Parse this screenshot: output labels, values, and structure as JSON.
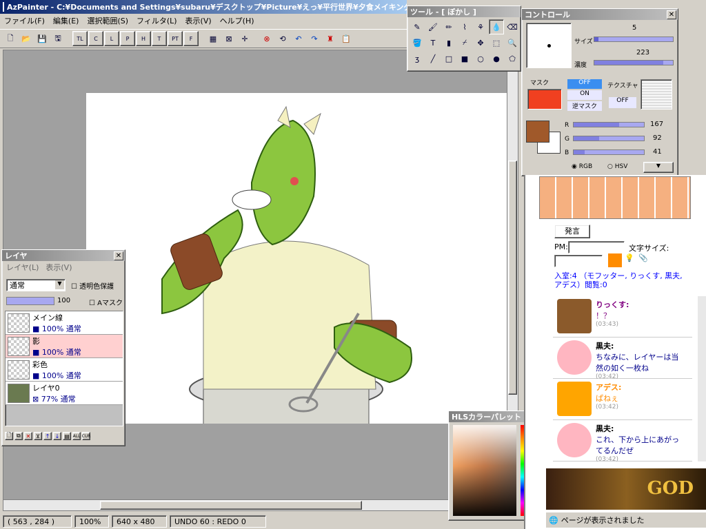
{
  "title": "AzPainter - C:¥Documents and Settings¥subaru¥デスクトップ¥Picture¥えっ¥平行世界¥夕食メイキング¥...",
  "menu": [
    "ファイル(F)",
    "編集(E)",
    "選択範囲(S)",
    "フィルタ(L)",
    "表示(V)",
    "ヘルプ(H)"
  ],
  "status": {
    "coords": "( 563 , 284 )",
    "zoom": "100%",
    "size": "640 x 480",
    "undo": "UNDO  60 : REDO   0"
  },
  "tool_window": {
    "title": "ツール - [ ぼかし ]"
  },
  "control": {
    "title": "コントロール",
    "size_label": "サイズ",
    "size_val": "5",
    "density_label": "濃度",
    "density_val": "223",
    "mask_label": "マスク",
    "texture_label": "テクスチャ",
    "mask_off": "OFF",
    "mask_on": "ON",
    "mask_rev": "逆マスク",
    "tex_off": "OFF",
    "r_label": "R",
    "r_val": "167",
    "g_label": "G",
    "g_val": "92",
    "b_label": "B",
    "b_val": "41",
    "rgb": "RGB",
    "hsv": "HSV",
    "fg_color": "#a0592a"
  },
  "layer_window": {
    "title": "レイヤ",
    "menu1": "レイヤ(L)",
    "menu2": "表示(V)",
    "blend": "通常",
    "protect": "透明色保護",
    "opacity": "100",
    "amask": "Aマスク",
    "layers": [
      {
        "name": "メイン線",
        "info": "100% 通常"
      },
      {
        "name": "影",
        "info": "100% 通常"
      },
      {
        "name": "彩色",
        "info": "100% 通常"
      },
      {
        "name": "レイヤ0",
        "info": "77% 通常"
      }
    ]
  },
  "hls": {
    "title": "HLSカラーパレット"
  },
  "chat": {
    "send": "発言",
    "pm_label": "PM:",
    "font_size_label": "文字サイズ:",
    "room": "入室:4 （モフッター, りっくす, 黒夫, アデス）閲覧:0",
    "messages": [
      {
        "name": "りっくす:",
        "text": "！？",
        "time": "(03:43)",
        "name_color": "#800080"
      },
      {
        "name": "黒夫:",
        "text": "ちなみに、レイヤーは当然の如く一枚ね",
        "time": "(03:42)",
        "name_color": "#000000"
      },
      {
        "name": "アデス:",
        "text": "ぱねぇ",
        "time": "(03:42)",
        "name_color": "#ff8c00"
      },
      {
        "name": "黒夫:",
        "text": "これ、下から上にあがってるんだぜ",
        "time": "(03:42)",
        "name_color": "#000000"
      }
    ],
    "footer": "ページが表示されました",
    "banner": "GOD"
  }
}
